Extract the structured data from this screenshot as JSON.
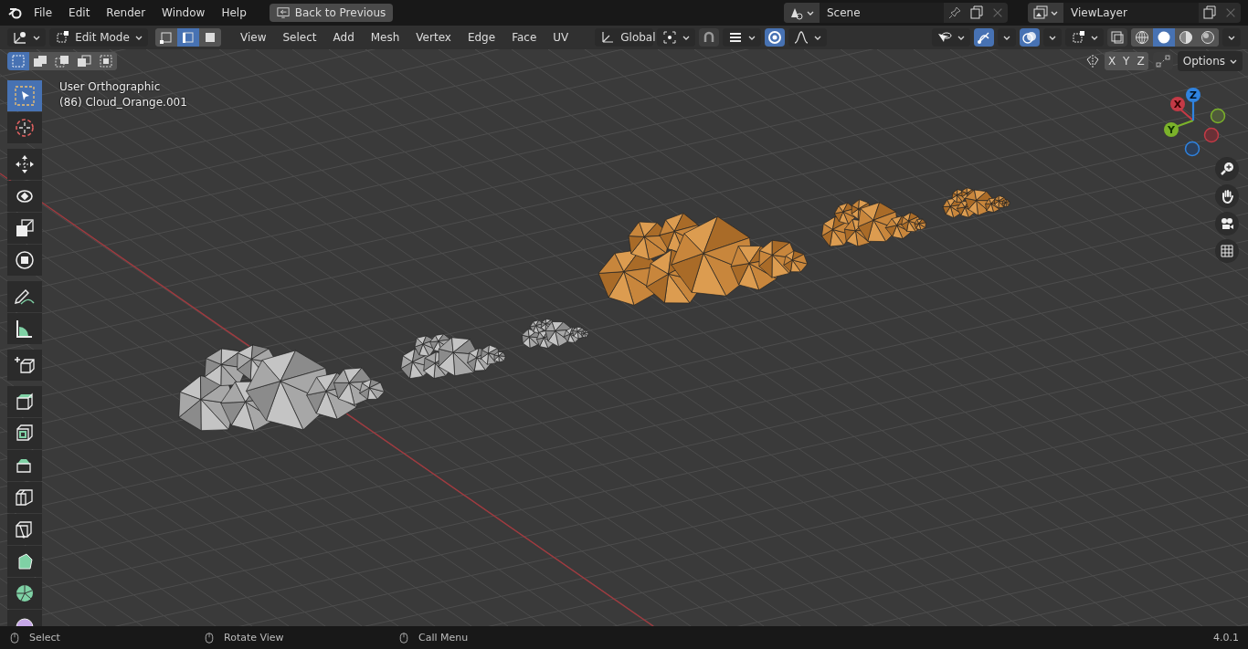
{
  "topbar": {
    "menus": [
      "File",
      "Edit",
      "Render",
      "Window",
      "Help"
    ],
    "back_button": "Back to Previous",
    "scene": "Scene",
    "view_layer": "ViewLayer"
  },
  "header": {
    "mode": "Edit Mode",
    "select_modes": [
      {
        "kind": "vertex",
        "selected": false
      },
      {
        "kind": "edge",
        "selected": true
      },
      {
        "kind": "face",
        "selected": false
      }
    ],
    "menus": [
      "View",
      "Select",
      "Add",
      "Mesh",
      "Vertex",
      "Edge",
      "Face",
      "UV"
    ],
    "orientation": "Global",
    "toggles": {
      "snap": false,
      "proportional": true,
      "gizmos": true,
      "overlays": true,
      "xray": false
    },
    "shading": [
      {
        "kind": "wireframe",
        "selected": false
      },
      {
        "kind": "solid",
        "selected": true
      },
      {
        "kind": "material",
        "selected": false
      },
      {
        "kind": "rendered",
        "selected": false
      }
    ]
  },
  "tool_settings": {
    "box_modes": [
      {
        "kind": "new",
        "selected": true
      },
      {
        "kind": "extend",
        "selected": false
      },
      {
        "kind": "subtract",
        "selected": false
      },
      {
        "kind": "invert",
        "selected": false
      },
      {
        "kind": "intersect",
        "selected": false
      }
    ],
    "mirror_axes": [
      {
        "label": "X",
        "on": false
      },
      {
        "label": "Y",
        "on": false
      },
      {
        "label": "Z",
        "on": false
      }
    ],
    "options": "Options"
  },
  "viewport": {
    "view_name": "User Orthographic",
    "object_name": "(86) Cloud_Orange.001",
    "clouds": [
      {
        "kind": "edit_mesh"
      },
      {
        "kind": "edit_mesh"
      },
      {
        "kind": "edit_mesh"
      },
      {
        "kind": "object"
      },
      {
        "kind": "object"
      },
      {
        "kind": "object"
      }
    ]
  },
  "tools": [
    {
      "kind": "select_box",
      "selected": true
    },
    {
      "kind": "cursor",
      "selected": false
    },
    {
      "kind": "move",
      "selected": false
    },
    {
      "kind": "rotate",
      "selected": false
    },
    {
      "kind": "scale",
      "selected": false
    },
    {
      "kind": "transform",
      "selected": false
    },
    {
      "kind": "annotate",
      "selected": false
    },
    {
      "kind": "measure",
      "selected": false
    },
    {
      "kind": "add_cube",
      "selected": false
    },
    {
      "kind": "extrude",
      "selected": false
    },
    {
      "kind": "inset",
      "selected": false
    },
    {
      "kind": "bevel",
      "selected": false
    },
    {
      "kind": "loop_cut",
      "selected": false
    },
    {
      "kind": "knife",
      "selected": false
    },
    {
      "kind": "poly_build",
      "selected": false
    },
    {
      "kind": "spin",
      "selected": false
    },
    {
      "kind": "smooth",
      "selected": false
    }
  ],
  "gizmo": {
    "axes": [
      "X",
      "Y",
      "Z"
    ]
  },
  "status_bar": {
    "hints": [
      "Select",
      "Rotate View",
      "Call Menu"
    ],
    "version": "4.0.1"
  }
}
